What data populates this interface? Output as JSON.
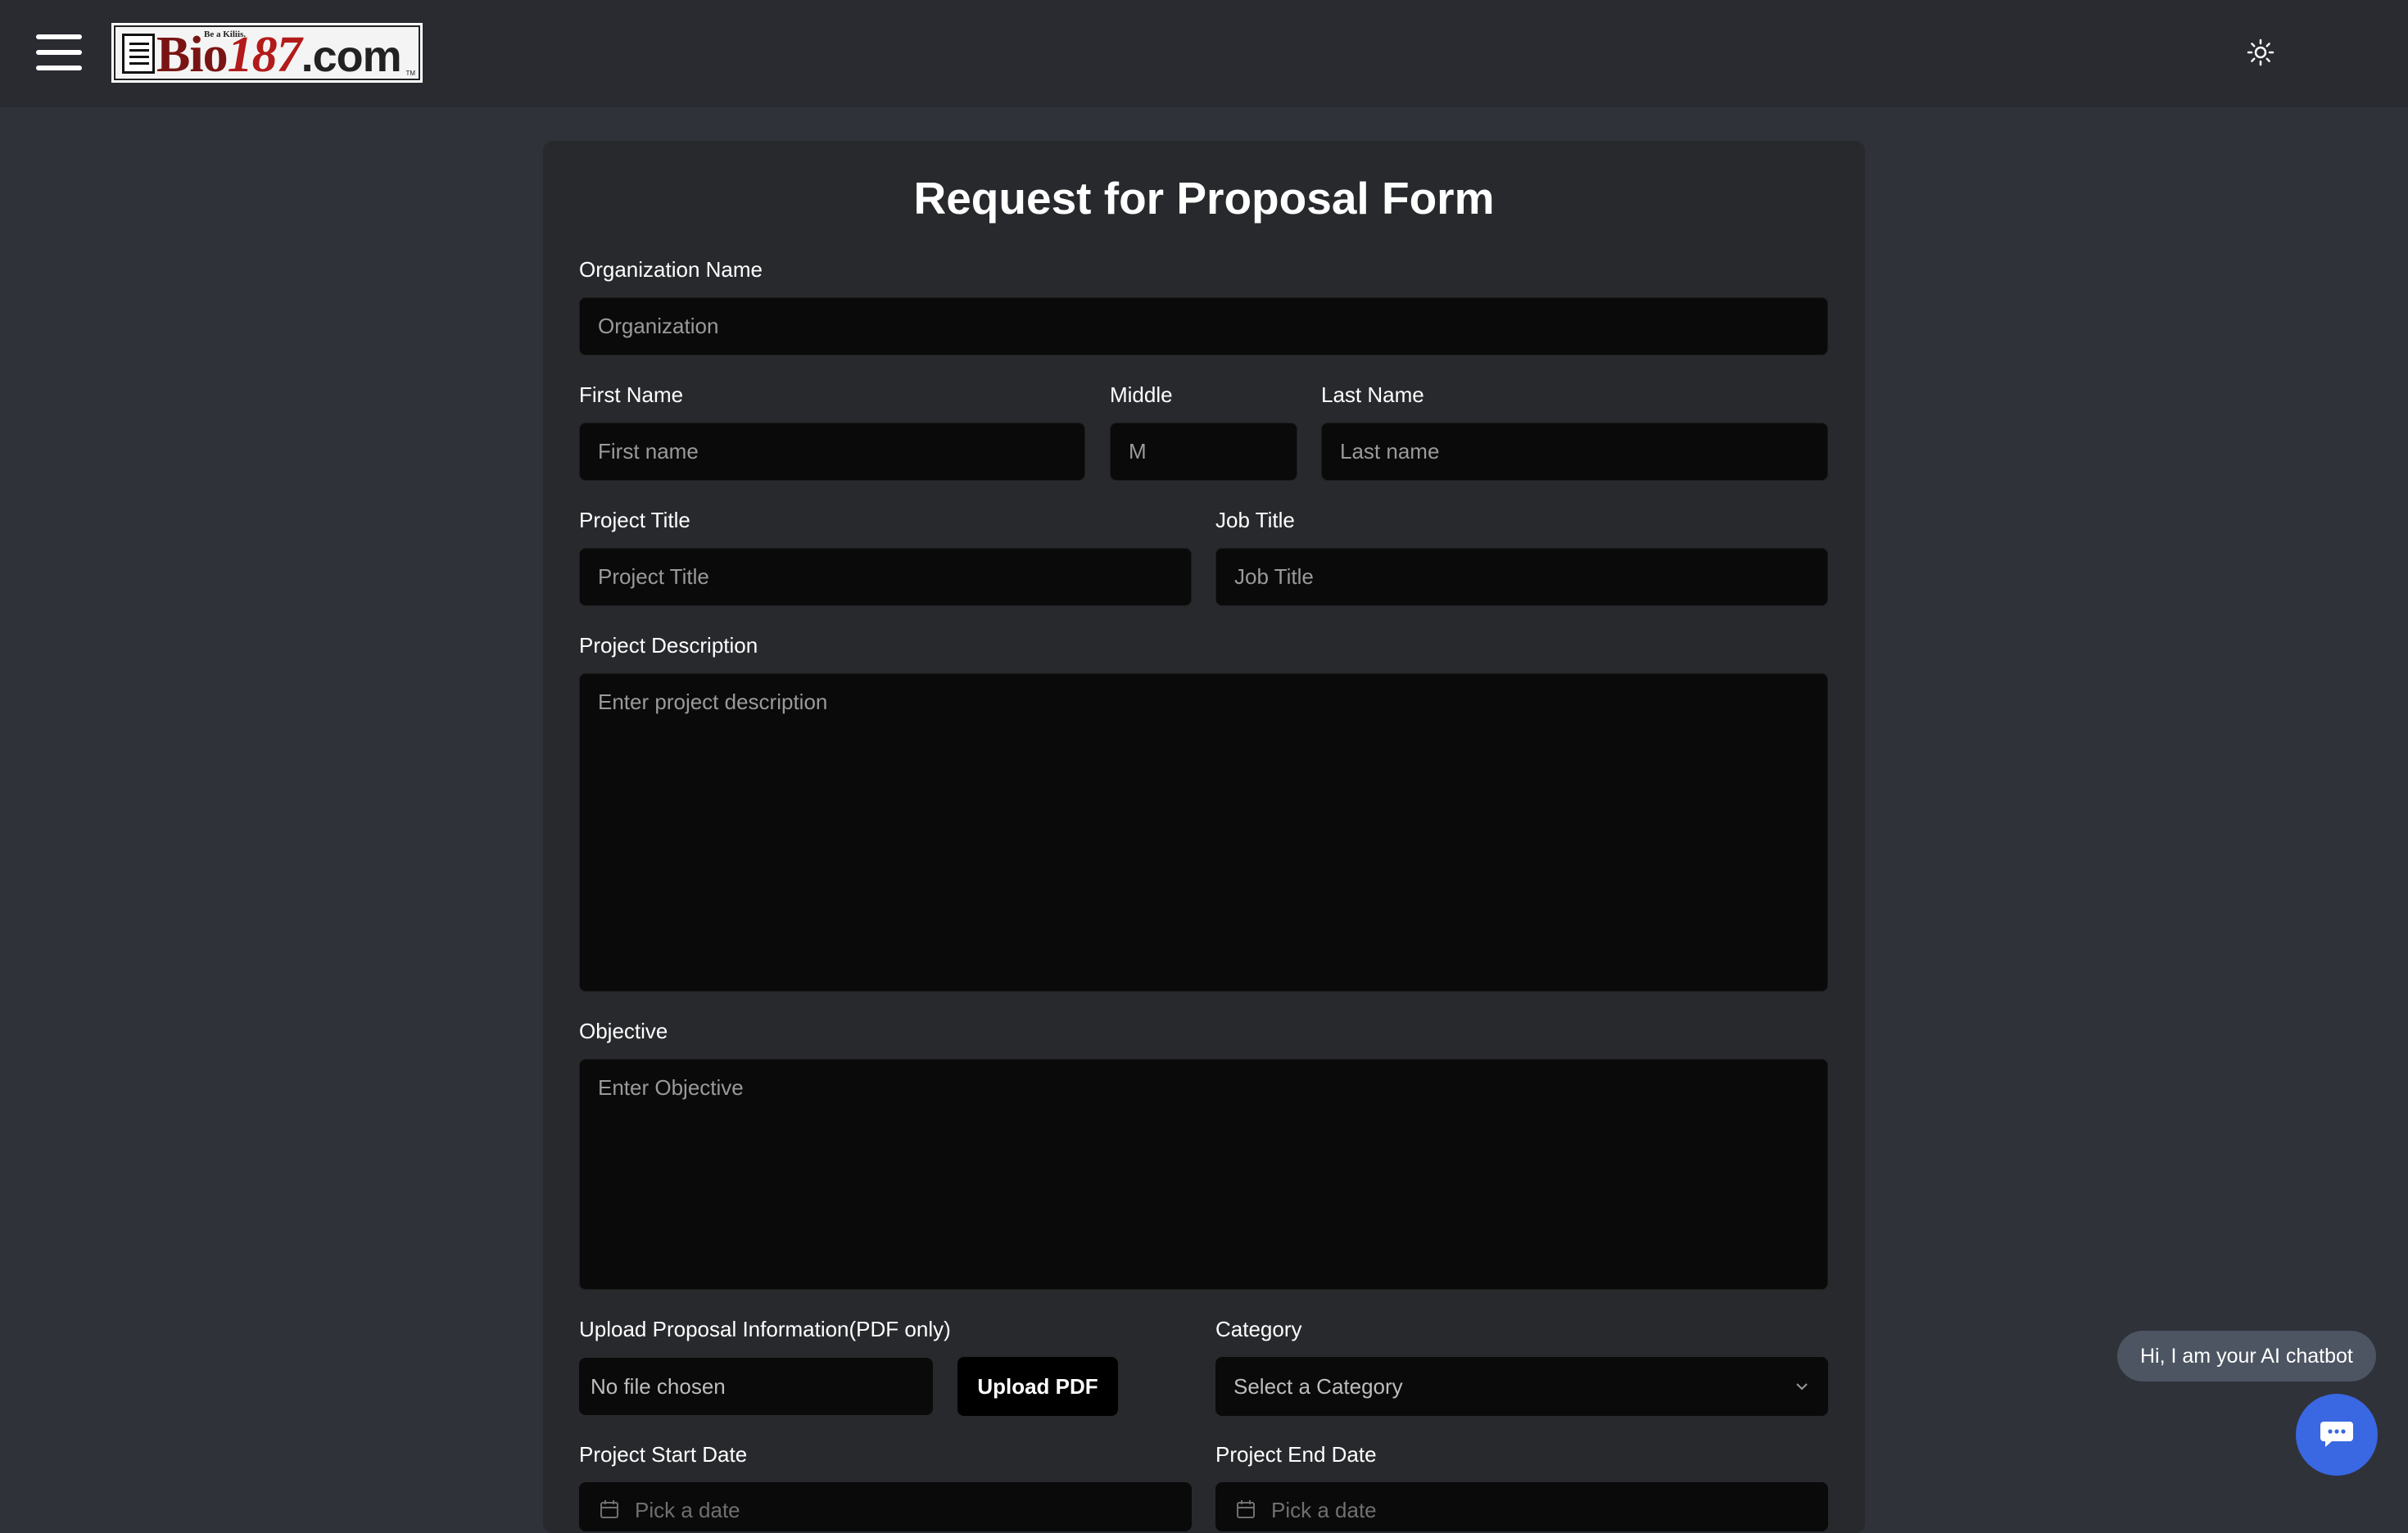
{
  "header": {
    "logo_tagline": "Be a Kiliis.",
    "logo_part1": "Bio",
    "logo_part2": "187",
    "logo_part3": ".com",
    "logo_tm": "TM"
  },
  "form": {
    "title": "Request for Proposal Form",
    "organization": {
      "label": "Organization Name",
      "placeholder": "Organization"
    },
    "first_name": {
      "label": "First Name",
      "placeholder": "First name"
    },
    "middle": {
      "label": "Middle",
      "placeholder": "M"
    },
    "last_name": {
      "label": "Last Name",
      "placeholder": "Last name"
    },
    "project_title": {
      "label": "Project Title",
      "placeholder": "Project Title"
    },
    "job_title": {
      "label": "Job Title",
      "placeholder": "Job Title"
    },
    "description": {
      "label": "Project Description",
      "placeholder": "Enter project description"
    },
    "objective": {
      "label": "Objective",
      "placeholder": "Enter Objective"
    },
    "upload": {
      "label": "Upload Proposal Information(PDF only)",
      "file_status": "No file chosen",
      "button": "Upload PDF"
    },
    "category": {
      "label": "Category",
      "selected": "Select a Category"
    },
    "start_date": {
      "label": "Project Start Date",
      "placeholder": "Pick a date"
    },
    "end_date": {
      "label": "Project End Date",
      "placeholder": "Pick a date"
    }
  },
  "chatbot": {
    "greeting": "Hi, I am your AI chatbot"
  },
  "colors": {
    "page_bg": "#2f3238",
    "header_bg": "#2a2b30",
    "card_bg": "#28292d",
    "input_bg": "#0b0a0a",
    "chat_button": "#3a67e2",
    "chat_bubble": "#4d5563"
  },
  "icons": {
    "menu": "hamburger-menu-icon",
    "theme": "sun-icon",
    "select": "chevron-down-icon",
    "date": "calendar-icon",
    "chat": "chat-icon"
  }
}
